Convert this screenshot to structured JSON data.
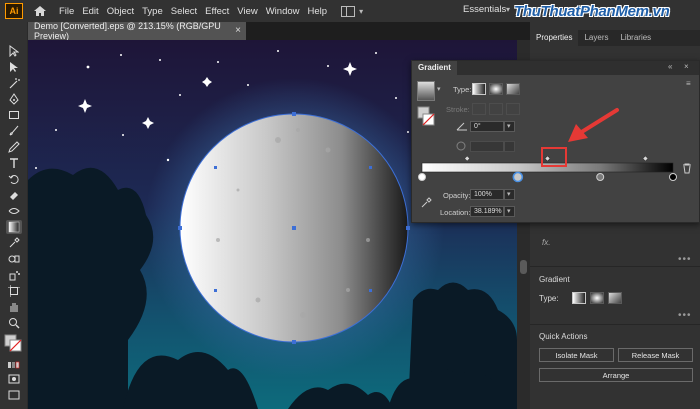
{
  "app": {
    "logo": "Ai"
  },
  "menu": [
    "File",
    "Edit",
    "Object",
    "Type",
    "Select",
    "Effect",
    "View",
    "Window",
    "Help"
  ],
  "workspace": {
    "label": "Essentials"
  },
  "watermark": "ThuThuatPhanMem.vn",
  "document_tab": {
    "title": "Demo [Converted].eps @ 213.15% (RGB/GPU Preview)",
    "close": "×"
  },
  "properties": {
    "tabs": [
      "Properties",
      "Layers",
      "Libraries"
    ],
    "fx_label": "fx.",
    "gradient_section": {
      "title": "Gradient",
      "type_label": "Type:"
    },
    "quick_actions": {
      "title": "Quick Actions",
      "isolate_mask": "Isolate Mask",
      "release_mask": "Release Mask",
      "arrange": "Arrange"
    },
    "more": "•••"
  },
  "gradient_panel": {
    "title": "Gradient",
    "type_label": "Type:",
    "stroke_label": "Stroke:",
    "angle_value": "0°",
    "opacity_label": "Opacity:",
    "opacity_value": "100%",
    "location_label": "Location:",
    "location_value": "38.189%",
    "stops": [
      {
        "location": 0,
        "color": "#ffffff"
      },
      {
        "location": 38.189,
        "color": "#c8c8c8"
      },
      {
        "location": 71,
        "color": "#7a7a7a"
      },
      {
        "location": 100,
        "color": "#000000"
      }
    ],
    "midpoints": [
      18,
      50,
      89
    ],
    "accent": "#4a90e2"
  },
  "colors": {
    "annotation": "#e53935",
    "selection": "#3d6fd6"
  },
  "icons": [
    "home-icon",
    "selection-tool-icon",
    "direct-selection-tool-icon",
    "pen-tool-icon",
    "type-tool-icon",
    "gradient-tool-icon",
    "eyedropper-icon",
    "trash-icon",
    "chevron-down-icon"
  ]
}
